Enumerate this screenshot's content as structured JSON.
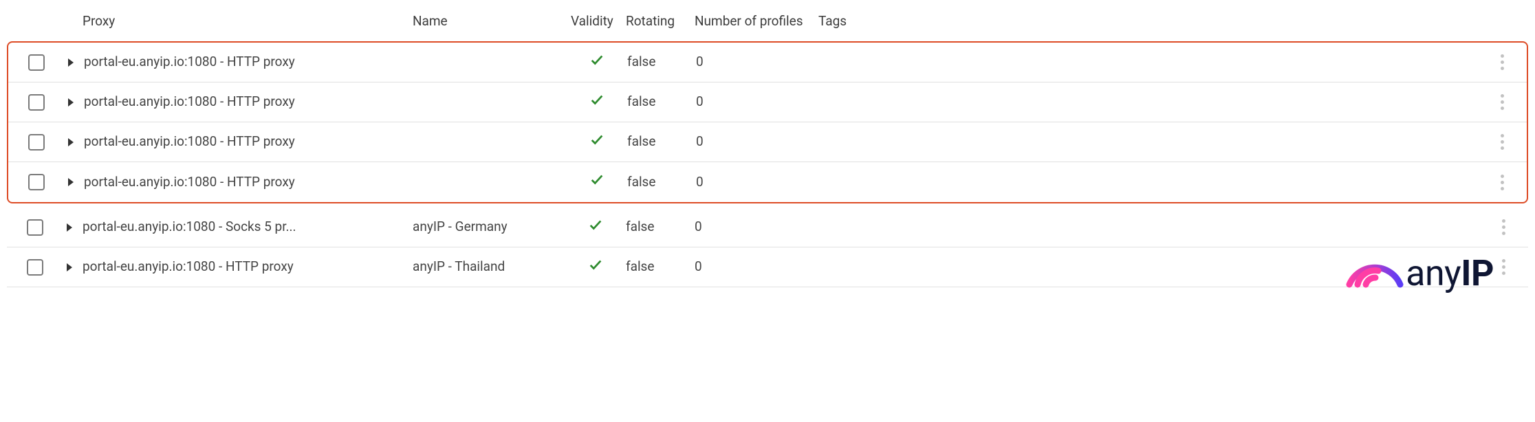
{
  "headers": {
    "proxy": "Proxy",
    "name": "Name",
    "validity": "Validity",
    "rotating": "Rotating",
    "profiles": "Number of profiles",
    "tags": "Tags"
  },
  "rows": [
    {
      "proxy": "portal-eu.anyip.io:1080 - HTTP proxy",
      "name": "",
      "valid": true,
      "rotating": "false",
      "profiles": "0",
      "tags": "",
      "highlighted": true
    },
    {
      "proxy": "portal-eu.anyip.io:1080 - HTTP proxy",
      "name": "",
      "valid": true,
      "rotating": "false",
      "profiles": "0",
      "tags": "",
      "highlighted": true
    },
    {
      "proxy": "portal-eu.anyip.io:1080 - HTTP proxy",
      "name": "",
      "valid": true,
      "rotating": "false",
      "profiles": "0",
      "tags": "",
      "highlighted": true
    },
    {
      "proxy": "portal-eu.anyip.io:1080 - HTTP proxy",
      "name": "",
      "valid": true,
      "rotating": "false",
      "profiles": "0",
      "tags": "",
      "highlighted": true
    },
    {
      "proxy": "portal-eu.anyip.io:1080 - Socks 5 pr...",
      "name": "anyIP - Germany",
      "valid": true,
      "rotating": "false",
      "profiles": "0",
      "tags": "",
      "highlighted": false
    },
    {
      "proxy": "portal-eu.anyip.io:1080 - HTTP proxy",
      "name": "anyIP - Thailand",
      "valid": true,
      "rotating": "false",
      "profiles": "0",
      "tags": "",
      "highlighted": false
    }
  ],
  "brand": {
    "prefix": "any",
    "suffix": "IP"
  },
  "highlight_color": "#dd4b25",
  "valid_color": "#2e8b2e"
}
